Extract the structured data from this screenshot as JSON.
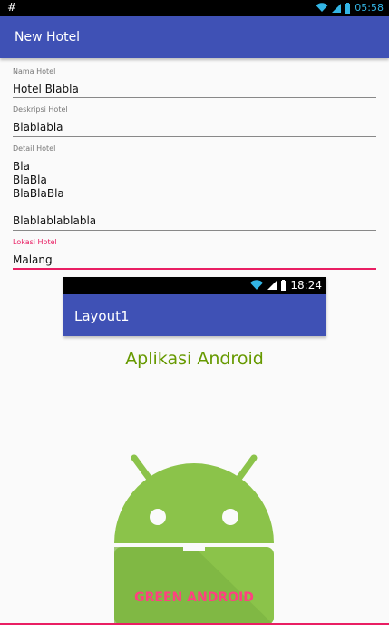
{
  "statusbar": {
    "left_glyph": "#",
    "time": "05:58",
    "icons": [
      "wifi-icon",
      "signal-icon",
      "battery-icon"
    ]
  },
  "appbar": {
    "title": "New Hotel"
  },
  "form": {
    "nama": {
      "label": "Nama Hotel",
      "value": "Hotel Blabla"
    },
    "deskripsi": {
      "label": "Deskripsi Hotel",
      "value": "Blablabla"
    },
    "detail": {
      "label": "Detail Hotel",
      "lines": [
        "Bla",
        "BlaBla",
        "BlaBlaBla",
        "",
        "Blablablablabla"
      ]
    },
    "lokasi": {
      "label": "Lokasi Hotel",
      "value": "Malang"
    }
  },
  "preview": {
    "statusbar_time": "18:24",
    "title": "Layout1",
    "headline": "Aplikasi Android",
    "caption": "GREEN ANDROID"
  },
  "colors": {
    "primary": "#3f51b5",
    "accent": "#e91e63",
    "android_green": "#8bc34a",
    "headline": "#669900"
  }
}
